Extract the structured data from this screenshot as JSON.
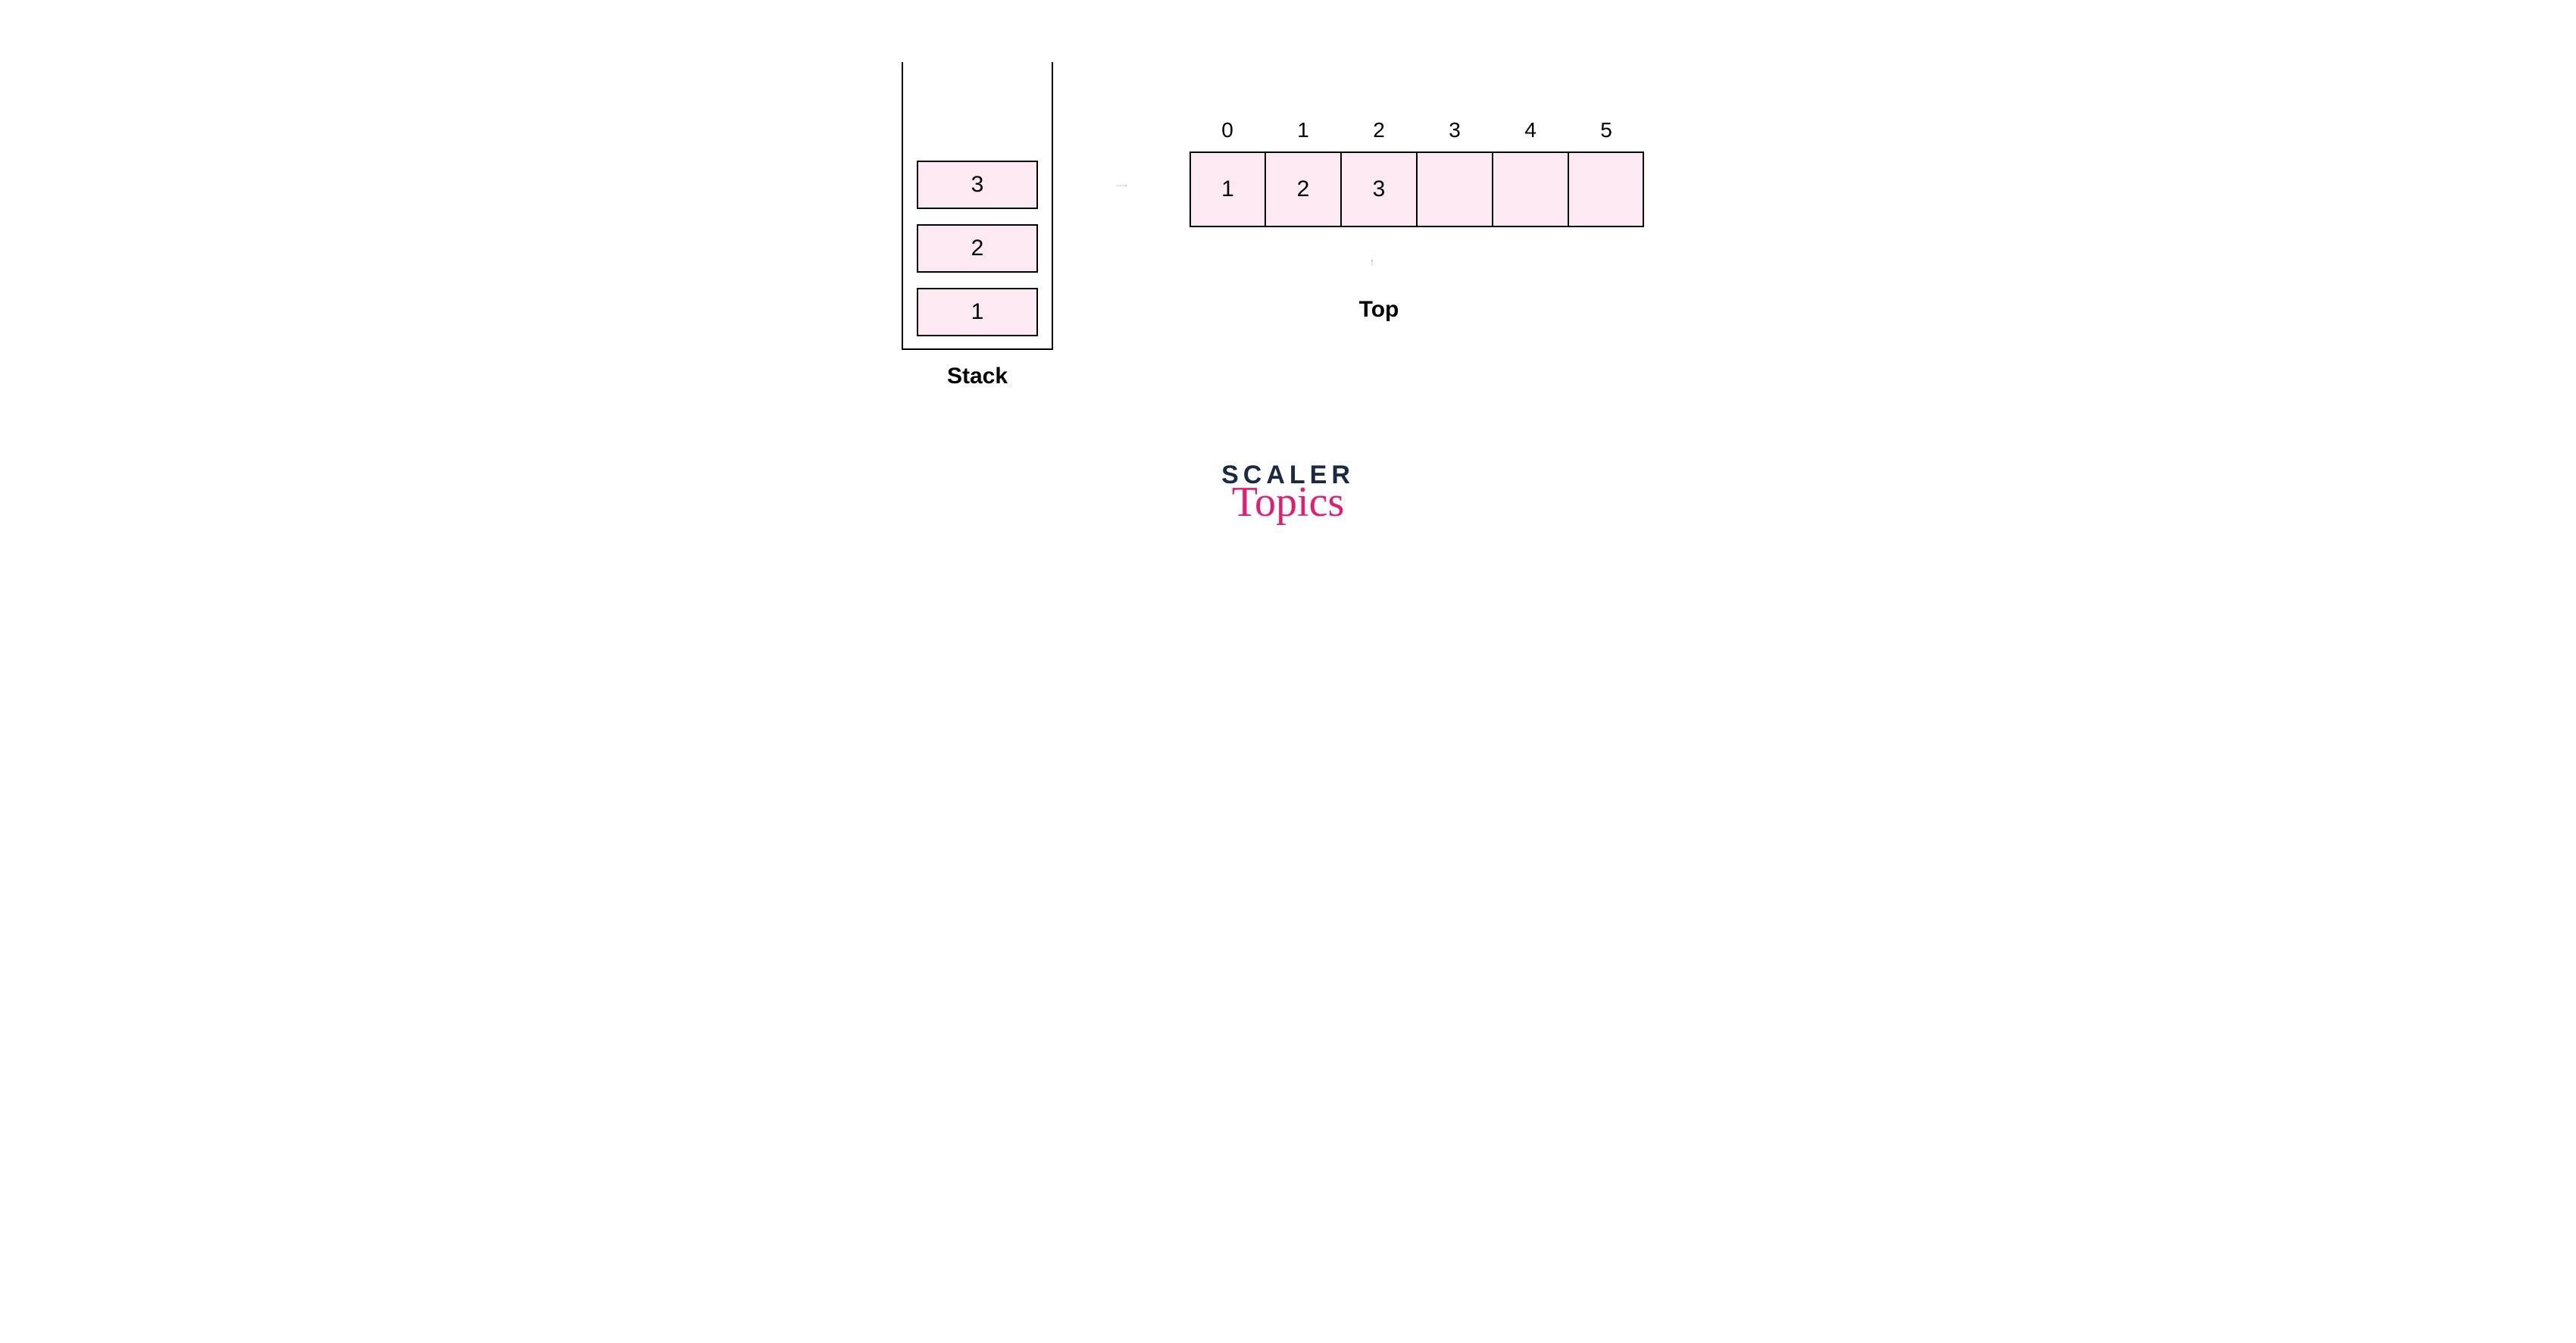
{
  "stack": {
    "label": "Stack",
    "cells": [
      "3",
      "2",
      "1"
    ]
  },
  "array": {
    "indices": [
      "0",
      "1",
      "2",
      "3",
      "4",
      "5"
    ],
    "values": [
      "1",
      "2",
      "3",
      "",
      "",
      ""
    ],
    "top_index": 2,
    "top_label": "Top"
  },
  "logo": {
    "line1": "SCALER",
    "line2": "Topics"
  },
  "colors": {
    "cell_fill": "#fce9f1",
    "border": "#000000",
    "logo_dark": "#1a2a44",
    "logo_pink": "#e11d74"
  }
}
